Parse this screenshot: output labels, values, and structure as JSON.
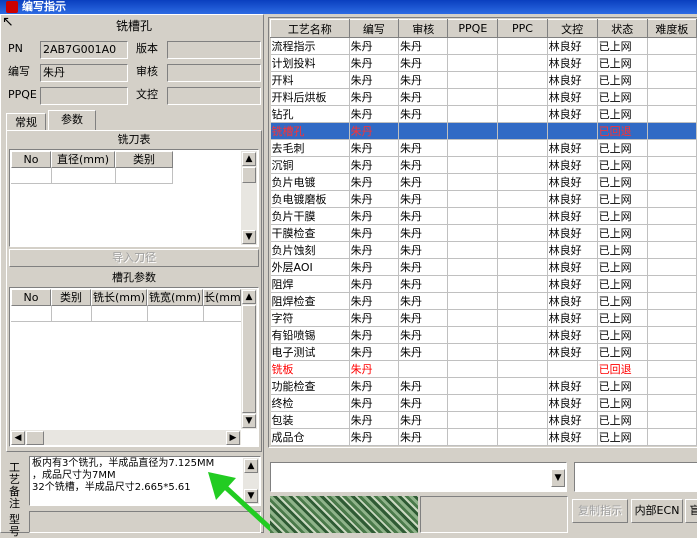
{
  "window": {
    "title": "编写指示"
  },
  "left": {
    "header": "铣槽孔",
    "fields": {
      "pn_label": "PN",
      "pn_value": "2AB7G001A0",
      "version_label": "版本",
      "version_value": "",
      "writer_label": "编写",
      "writer_value": "朱丹",
      "review_label": "审核",
      "review_value": "",
      "ppqe_label": "PPQE",
      "ppqe_value": "",
      "doc_label": "文控",
      "doc_value": ""
    },
    "tabs": [
      "常规",
      "参数"
    ],
    "tool_table": {
      "title": "铣刀表",
      "columns": [
        "No",
        "直径(mm)",
        "类别"
      ]
    },
    "import_button": "导入刀径",
    "slot_table": {
      "title": "槽孔参数",
      "columns": [
        "No",
        "类别",
        "铣长(mm)",
        "铣宽(mm)",
        "长(mm"
      ]
    },
    "remark_label": "工艺备注",
    "remark_lines": [
      "板内有3个铣孔，半成品直径为7.125MM",
      "，成品尺寸为7MM",
      "32个铣槽，半成品尺寸2.665*5.61"
    ],
    "model_label": "型号"
  },
  "grid": {
    "columns": [
      "工艺名称",
      "编写",
      "审核",
      "PPQE",
      "PPC",
      "文控",
      "状态",
      "难度板"
    ],
    "rows": [
      [
        "流程指示",
        "朱丹",
        "朱丹",
        "",
        "",
        "林良好",
        "已上网",
        "",
        "normal"
      ],
      [
        "计划投料",
        "朱丹",
        "朱丹",
        "",
        "",
        "林良好",
        "已上网",
        "",
        "normal"
      ],
      [
        "开料",
        "朱丹",
        "朱丹",
        "",
        "",
        "林良好",
        "已上网",
        "",
        "normal"
      ],
      [
        "开料后烘板",
        "朱丹",
        "朱丹",
        "",
        "",
        "林良好",
        "已上网",
        "",
        "normal"
      ],
      [
        "钻孔",
        "朱丹",
        "朱丹",
        "",
        "",
        "林良好",
        "已上网",
        "",
        "normal"
      ],
      [
        "铣槽孔",
        "朱丹",
        "",
        "",
        "",
        "",
        "已回退",
        "",
        "selected"
      ],
      [
        "去毛刺",
        "朱丹",
        "朱丹",
        "",
        "",
        "林良好",
        "已上网",
        "",
        "normal"
      ],
      [
        "沉铜",
        "朱丹",
        "朱丹",
        "",
        "",
        "林良好",
        "已上网",
        "",
        "normal"
      ],
      [
        "负片电镀",
        "朱丹",
        "朱丹",
        "",
        "",
        "林良好",
        "已上网",
        "",
        "normal"
      ],
      [
        "负电镀磨板",
        "朱丹",
        "朱丹",
        "",
        "",
        "林良好",
        "已上网",
        "",
        "normal"
      ],
      [
        "负片干膜",
        "朱丹",
        "朱丹",
        "",
        "",
        "林良好",
        "已上网",
        "",
        "normal"
      ],
      [
        "干膜检查",
        "朱丹",
        "朱丹",
        "",
        "",
        "林良好",
        "已上网",
        "",
        "normal"
      ],
      [
        "负片蚀刻",
        "朱丹",
        "朱丹",
        "",
        "",
        "林良好",
        "已上网",
        "",
        "normal"
      ],
      [
        "外层AOI",
        "朱丹",
        "朱丹",
        "",
        "",
        "林良好",
        "已上网",
        "",
        "normal"
      ],
      [
        "阻焊",
        "朱丹",
        "朱丹",
        "",
        "",
        "林良好",
        "已上网",
        "",
        "normal"
      ],
      [
        "阻焊检查",
        "朱丹",
        "朱丹",
        "",
        "",
        "林良好",
        "已上网",
        "",
        "normal"
      ],
      [
        "字符",
        "朱丹",
        "朱丹",
        "",
        "",
        "林良好",
        "已上网",
        "",
        "normal"
      ],
      [
        "有铅喷锡",
        "朱丹",
        "朱丹",
        "",
        "",
        "林良好",
        "已上网",
        "",
        "normal"
      ],
      [
        "电子测试",
        "朱丹",
        "朱丹",
        "",
        "",
        "林良好",
        "已上网",
        "",
        "normal"
      ],
      [
        "铣板",
        "朱丹",
        "",
        "",
        "",
        "",
        "已回退",
        "",
        "red"
      ],
      [
        "功能检查",
        "朱丹",
        "朱丹",
        "",
        "",
        "林良好",
        "已上网",
        "",
        "normal"
      ],
      [
        "终检",
        "朱丹",
        "朱丹",
        "",
        "",
        "林良好",
        "已上网",
        "",
        "normal"
      ],
      [
        "包装",
        "朱丹",
        "朱丹",
        "",
        "",
        "林良好",
        "已上网",
        "",
        "normal"
      ],
      [
        "成品仓",
        "朱丹",
        "朱丹",
        "",
        "",
        "林良好",
        "已上网",
        "",
        "normal"
      ]
    ]
  },
  "bottom": {
    "copy_button": "复制指示",
    "internal_ecn_button": "内部ECN",
    "third_button": "盲"
  },
  "colors": {
    "selection": "#316ac5",
    "rollback_text": "#ff0000",
    "arrow": "#22cc22"
  }
}
